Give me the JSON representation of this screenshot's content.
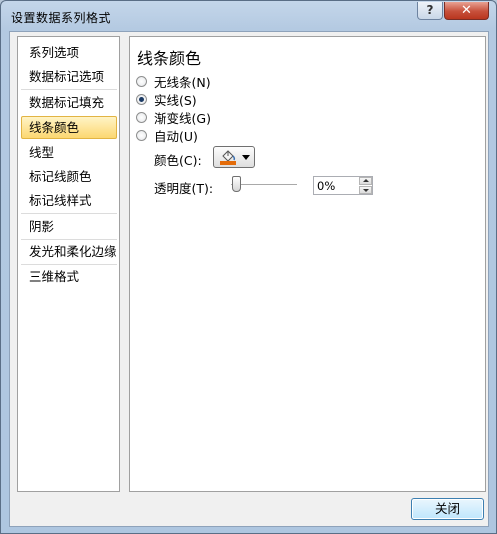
{
  "window": {
    "title": "设置数据系列格式",
    "help_label": "?",
    "close_label": "✕"
  },
  "nav": {
    "items": [
      {
        "label": "系列选项",
        "selected": false
      },
      {
        "label": "数据标记选项",
        "selected": false
      },
      {
        "label": "数据标记填充",
        "selected": false
      },
      {
        "label": "线条颜色",
        "selected": true
      },
      {
        "label": "线型",
        "selected": false
      },
      {
        "label": "标记线颜色",
        "selected": false
      },
      {
        "label": "标记线样式",
        "selected": false
      },
      {
        "label": "阴影",
        "selected": false
      },
      {
        "label": "发光和柔化边缘",
        "selected": false
      },
      {
        "label": "三维格式",
        "selected": false
      }
    ]
  },
  "panel": {
    "title": "线条颜色",
    "options": [
      {
        "label": "无线条(N)",
        "checked": false
      },
      {
        "label": "实线(S)",
        "checked": true
      },
      {
        "label": "渐变线(G)",
        "checked": false
      },
      {
        "label": "自动(U)",
        "checked": false
      }
    ],
    "color_label": "颜色(C):",
    "color_icon": "paint-bucket-icon",
    "color_value": "#e46c0a",
    "transparency_label": "透明度(T):",
    "transparency_value": "0%",
    "transparency_percent": 0
  },
  "footer": {
    "close_button": "关闭"
  },
  "colors": {
    "selected_bg": "#fcd771",
    "close_red": "#c7503b",
    "frame_blue": "#b3c9e1"
  }
}
